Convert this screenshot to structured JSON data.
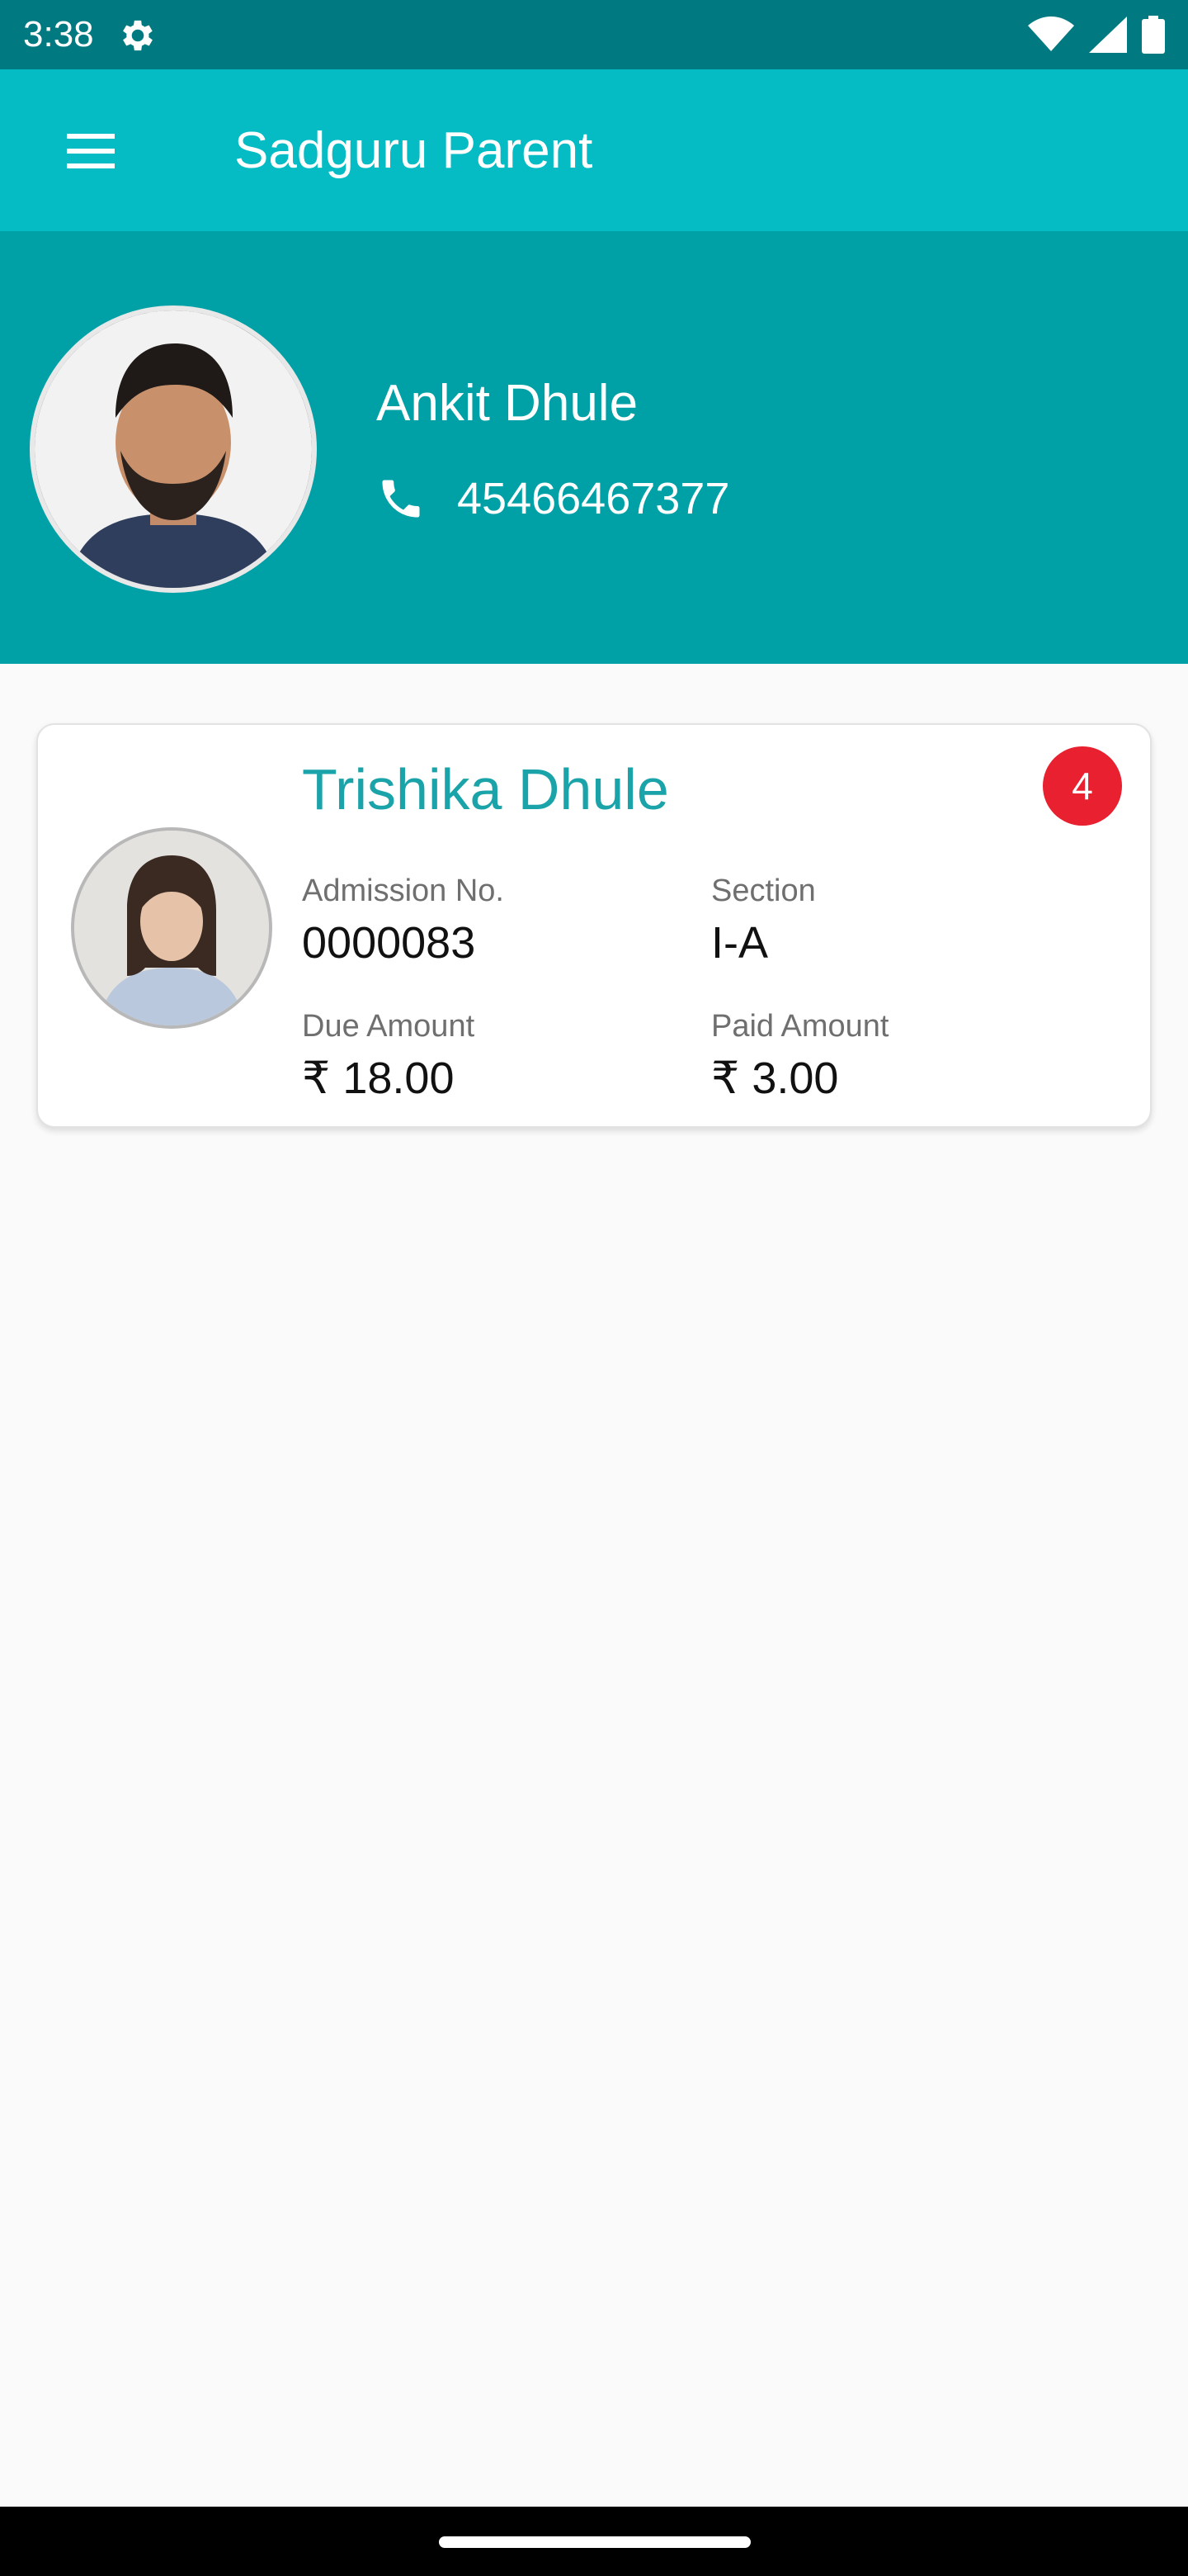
{
  "status_bar": {
    "time": "3:38",
    "icons": [
      "gear-icon",
      "wifi-icon",
      "signal-icon",
      "battery-icon"
    ]
  },
  "app_bar": {
    "title": "Sadguru Parent",
    "menu_icon": "hamburger-menu-icon"
  },
  "parent": {
    "name": "Ankit Dhule",
    "phone": "45466467377",
    "phone_icon": "phone-icon"
  },
  "student": {
    "name": "Trishika  Dhule",
    "badge_count": "4",
    "admission_label": "Admission No.",
    "admission_value": "0000083",
    "section_label": "Section",
    "section_value": "I-A",
    "due_label": "Due Amount",
    "due_value": "₹ 18.00",
    "paid_label": "Paid Amount",
    "paid_value": "₹ 3.00"
  },
  "colors": {
    "status_bar": "#007a80",
    "app_bar": "#05bbc4",
    "header": "#00a1a6",
    "accent": "#1aa3a8",
    "badge": "#e8202f"
  }
}
